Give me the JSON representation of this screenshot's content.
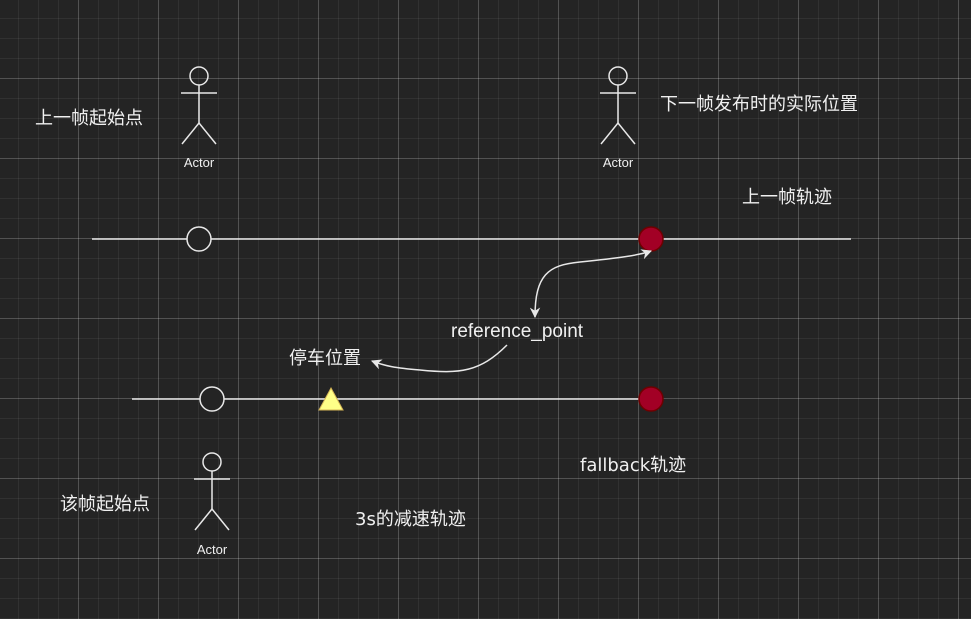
{
  "diagram": {
    "labels": {
      "prev_start": "上一帧起始点",
      "actual_pos": "下一帧发布时的实际位置",
      "prev_traj": "上一帧轨迹",
      "reference_point": "reference_point",
      "stop_pos": "停车位置",
      "fallback_traj": "fallback轨迹",
      "cur_start": "该帧起始点",
      "decel_traj": "3s的减速轨迹"
    },
    "actors": [
      {
        "label": "Actor"
      },
      {
        "label": "Actor"
      },
      {
        "label": "Actor"
      }
    ],
    "colors": {
      "line": "#e8e8e8",
      "red_node_fill": "#a20025",
      "red_node_stroke": "#6f0000",
      "triangle_fill": "#ffff88",
      "triangle_stroke": "#d6b656",
      "background": "#242424"
    }
  }
}
